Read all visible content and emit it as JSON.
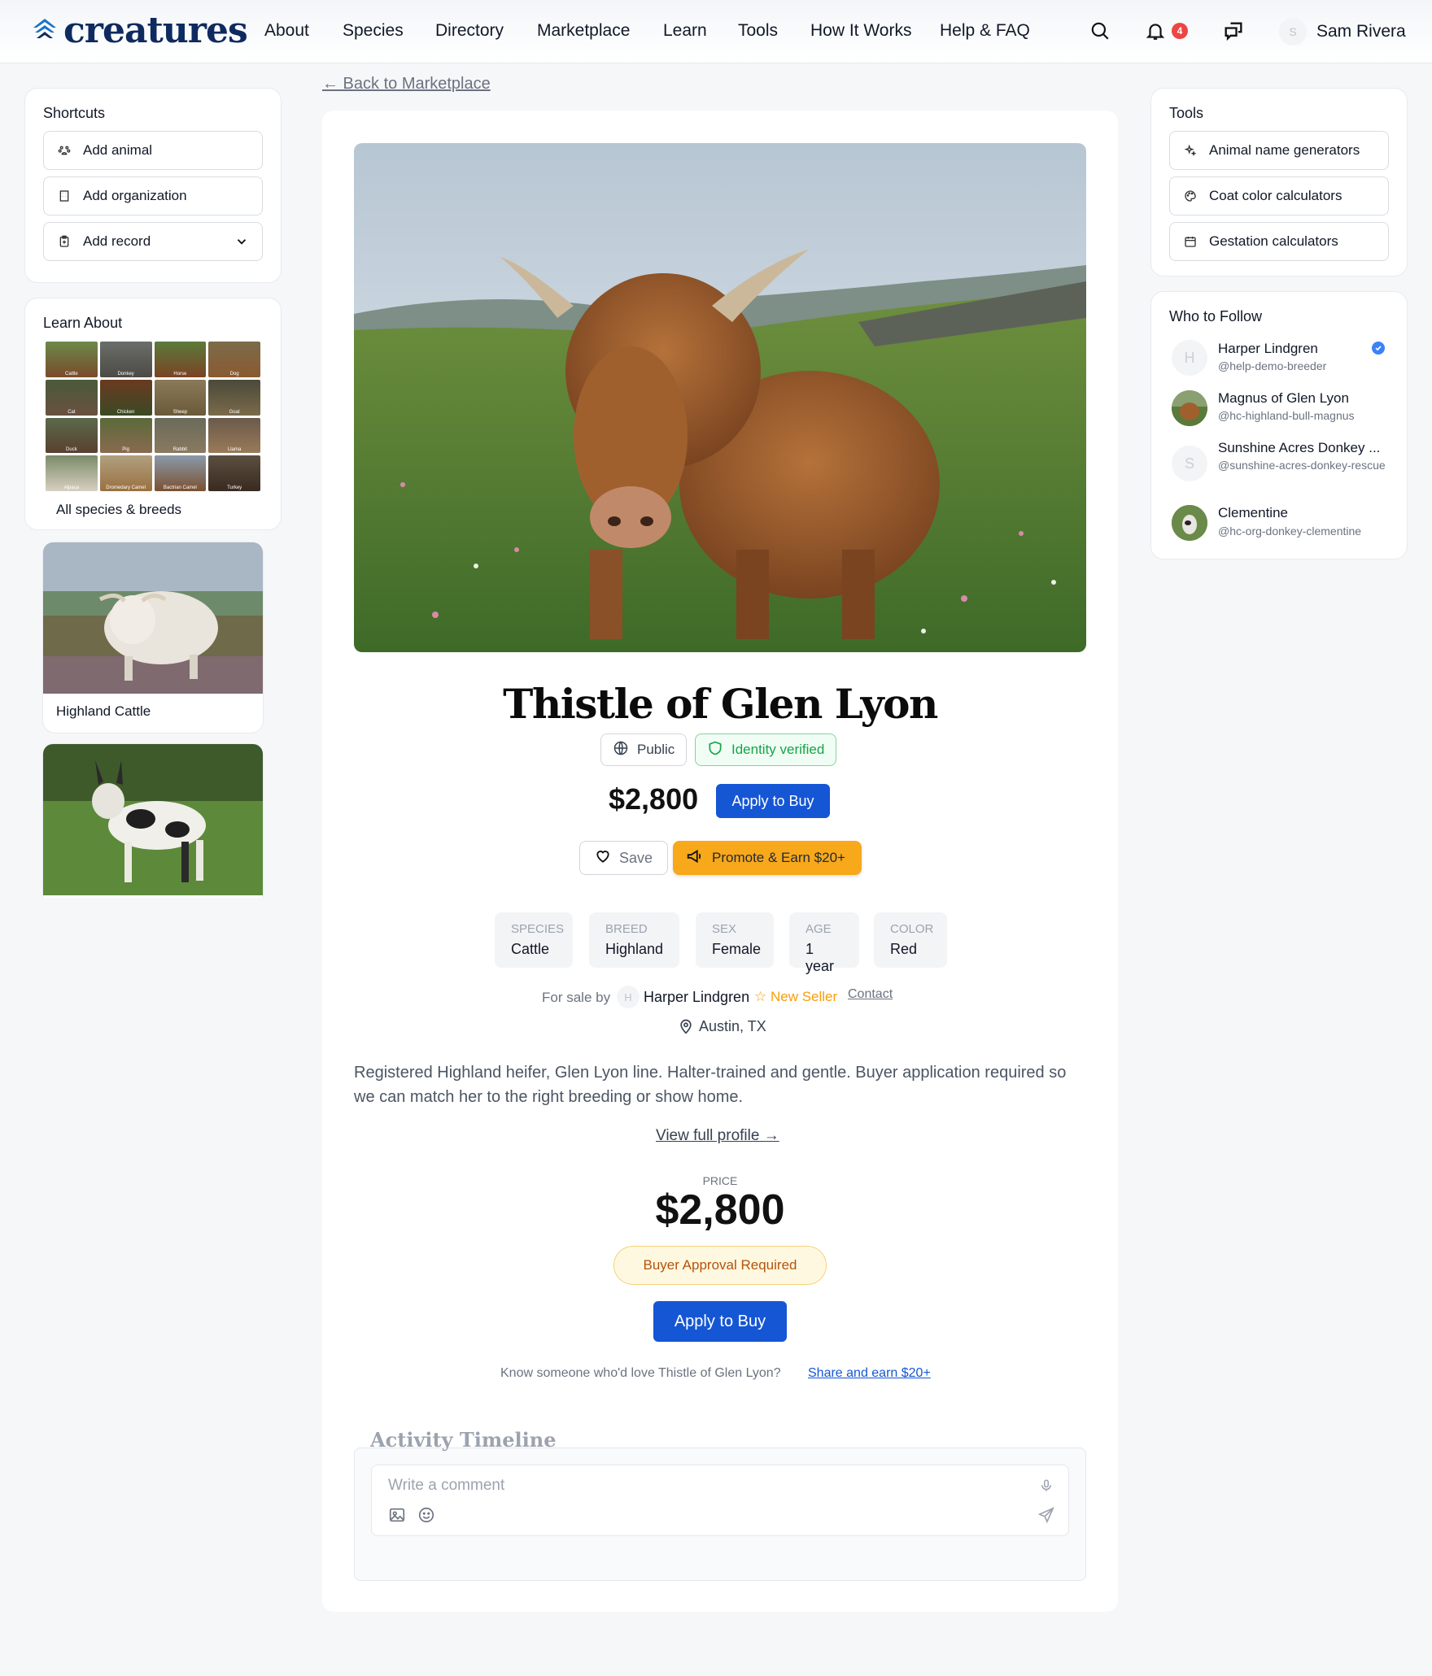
{
  "header": {
    "logo_text": "creatures",
    "nav": [
      "About",
      "Species",
      "Directory",
      "Marketplace",
      "Learn",
      "Tools",
      "How It Works",
      "Help & FAQ"
    ],
    "notification_count": "4",
    "user_initial": "S",
    "user_name": "Sam Rivera"
  },
  "shortcuts": {
    "title": "Shortcuts",
    "items": [
      {
        "label": "Add animal",
        "icon": "paw-icon"
      },
      {
        "label": "Add organization",
        "icon": "building-icon"
      },
      {
        "label": "Add record",
        "icon": "clipboard-icon"
      }
    ]
  },
  "learn": {
    "title": "Learn About",
    "species": [
      "Cattle",
      "Donkey",
      "Horse",
      "Dog",
      "Cat",
      "Chicken",
      "Sheep",
      "Goat",
      "Duck",
      "Pig",
      "Rabbit",
      "Llama",
      "Alpaca",
      "Dromedary Camel",
      "Bactrian Camel",
      "Turkey"
    ],
    "all_label": "All species & breeds",
    "cards": [
      {
        "label": "Highland Cattle"
      }
    ]
  },
  "main": {
    "back_label": "← Back to Marketplace",
    "title": "Thistle of Glen Lyon",
    "visibility": "Public",
    "verified": "Identity verified",
    "price": "$2,800",
    "apply_label": "Apply to Buy",
    "save_label": "Save",
    "promote_label": "Promote & Earn $20+",
    "specs": [
      {
        "key": "Species",
        "value": "Cattle"
      },
      {
        "key": "Breed",
        "value": "Highland"
      },
      {
        "key": "Sex",
        "value": "Female"
      },
      {
        "key": "Age",
        "value": "1 year"
      },
      {
        "key": "Color",
        "value": "Red"
      }
    ],
    "seller_prefix": "For sale by",
    "seller_initial": "H",
    "seller_name": "Harper Lindgren",
    "seller_badge": "☆ New Seller",
    "contact_label": "Contact",
    "location": "Austin, TX",
    "description": "Registered Highland heifer, Glen Lyon line. Halter-trained and gentle. Buyer application required so we can match her to the right breeding or show home.",
    "view_profile": "View full profile →",
    "price_label": "PRICE",
    "approval_label": "Buyer Approval Required",
    "share_prompt": "Know someone who'd love Thistle of Glen Lyon?",
    "share_link": "Share and earn $20+",
    "timeline_title": "Activity Timeline",
    "comment_placeholder": "Write a comment"
  },
  "tools": {
    "title": "Tools",
    "items": [
      {
        "label": "Animal name generators",
        "icon": "sparkles-icon"
      },
      {
        "label": "Coat color calculators",
        "icon": "palette-icon"
      },
      {
        "label": "Gestation calculators",
        "icon": "calendar-icon"
      }
    ]
  },
  "follow": {
    "title": "Who to Follow",
    "people": [
      {
        "name": "Harper Lindgren",
        "handle": "@help-demo-breeder",
        "initial": "H",
        "verified": true
      },
      {
        "name": "Magnus of Glen Lyon",
        "handle": "@hc-highland-bull-magnus",
        "initial": ""
      },
      {
        "name": "Sunshine Acres Donkey ...",
        "handle": "@sunshine-acres-donkey-rescue",
        "initial": "S"
      },
      {
        "name": "Clementine",
        "handle": "@hc-org-donkey-clementine",
        "initial": ""
      }
    ]
  },
  "colors": {
    "accent": "#1556d4",
    "promote": "#f7a81b",
    "verified": "#16a34a",
    "brand": "#0f2a5f"
  }
}
